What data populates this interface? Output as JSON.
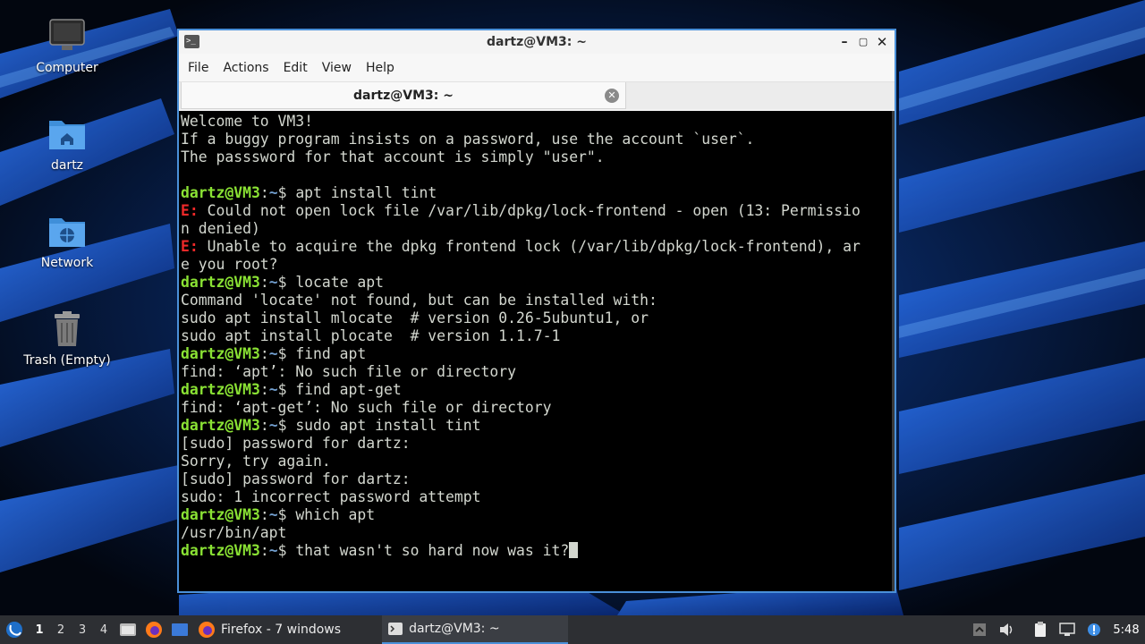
{
  "desktop": {
    "icons": [
      {
        "label": "Computer",
        "icon": "computer-icon"
      },
      {
        "label": "dartz",
        "icon": "home-folder-icon"
      },
      {
        "label": "Network",
        "icon": "network-folder-icon"
      },
      {
        "label": "Trash (Empty)",
        "icon": "trash-icon"
      }
    ]
  },
  "window": {
    "title": "dartz@VM3: ~",
    "menu": [
      "File",
      "Actions",
      "Edit",
      "View",
      "Help"
    ],
    "tab_label": "dartz@VM3: ~",
    "prompt_user": "dartz@VM3",
    "prompt_path": "~"
  },
  "terminal": {
    "lines": [
      {
        "type": "out",
        "text": "Welcome to VM3!"
      },
      {
        "type": "out",
        "text": "If a buggy program insists on a password, use the account `user`."
      },
      {
        "type": "out",
        "text": "The passsword for that account is simply \"user\"."
      },
      {
        "type": "out",
        "text": ""
      },
      {
        "type": "cmd",
        "text": "apt install tint"
      },
      {
        "type": "err",
        "tag": "E:",
        "text": " Could not open lock file /var/lib/dpkg/lock-frontend - open (13: Permissio"
      },
      {
        "type": "out",
        "text": "n denied)"
      },
      {
        "type": "err",
        "tag": "E:",
        "text": " Unable to acquire the dpkg frontend lock (/var/lib/dpkg/lock-frontend), ar"
      },
      {
        "type": "out",
        "text": "e you root?"
      },
      {
        "type": "cmd",
        "text": "locate apt"
      },
      {
        "type": "out",
        "text": "Command 'locate' not found, but can be installed with:"
      },
      {
        "type": "out",
        "text": "sudo apt install mlocate  # version 0.26-5ubuntu1, or"
      },
      {
        "type": "out",
        "text": "sudo apt install plocate  # version 1.1.7-1"
      },
      {
        "type": "cmd",
        "text": "find apt"
      },
      {
        "type": "out",
        "text": "find: ‘apt’: No such file or directory"
      },
      {
        "type": "cmd",
        "text": "find apt-get"
      },
      {
        "type": "out",
        "text": "find: ‘apt-get’: No such file or directory"
      },
      {
        "type": "cmd",
        "text": "sudo apt install tint"
      },
      {
        "type": "out",
        "text": "[sudo] password for dartz:"
      },
      {
        "type": "out",
        "text": "Sorry, try again."
      },
      {
        "type": "out",
        "text": "[sudo] password for dartz:"
      },
      {
        "type": "out",
        "text": "sudo: 1 incorrect password attempt"
      },
      {
        "type": "cmd",
        "text": "which apt"
      },
      {
        "type": "out",
        "text": "/usr/bin/apt"
      },
      {
        "type": "cmd",
        "text": "that wasn't so hard now was it?",
        "cursor": true
      }
    ]
  },
  "taskbar": {
    "workspaces": [
      "1",
      "2",
      "3",
      "4"
    ],
    "active_workspace": "1",
    "tasks": [
      {
        "label": "Firefox - 7 windows",
        "icon": "firefox-icon"
      },
      {
        "label": "dartz@VM3: ~",
        "icon": "terminal-icon"
      }
    ],
    "clock": "5:48"
  },
  "colors": {
    "prompt_user": "#8ae234",
    "prompt_path": "#729fcf",
    "error": "#ef2929",
    "accent": "#4a90d9"
  }
}
